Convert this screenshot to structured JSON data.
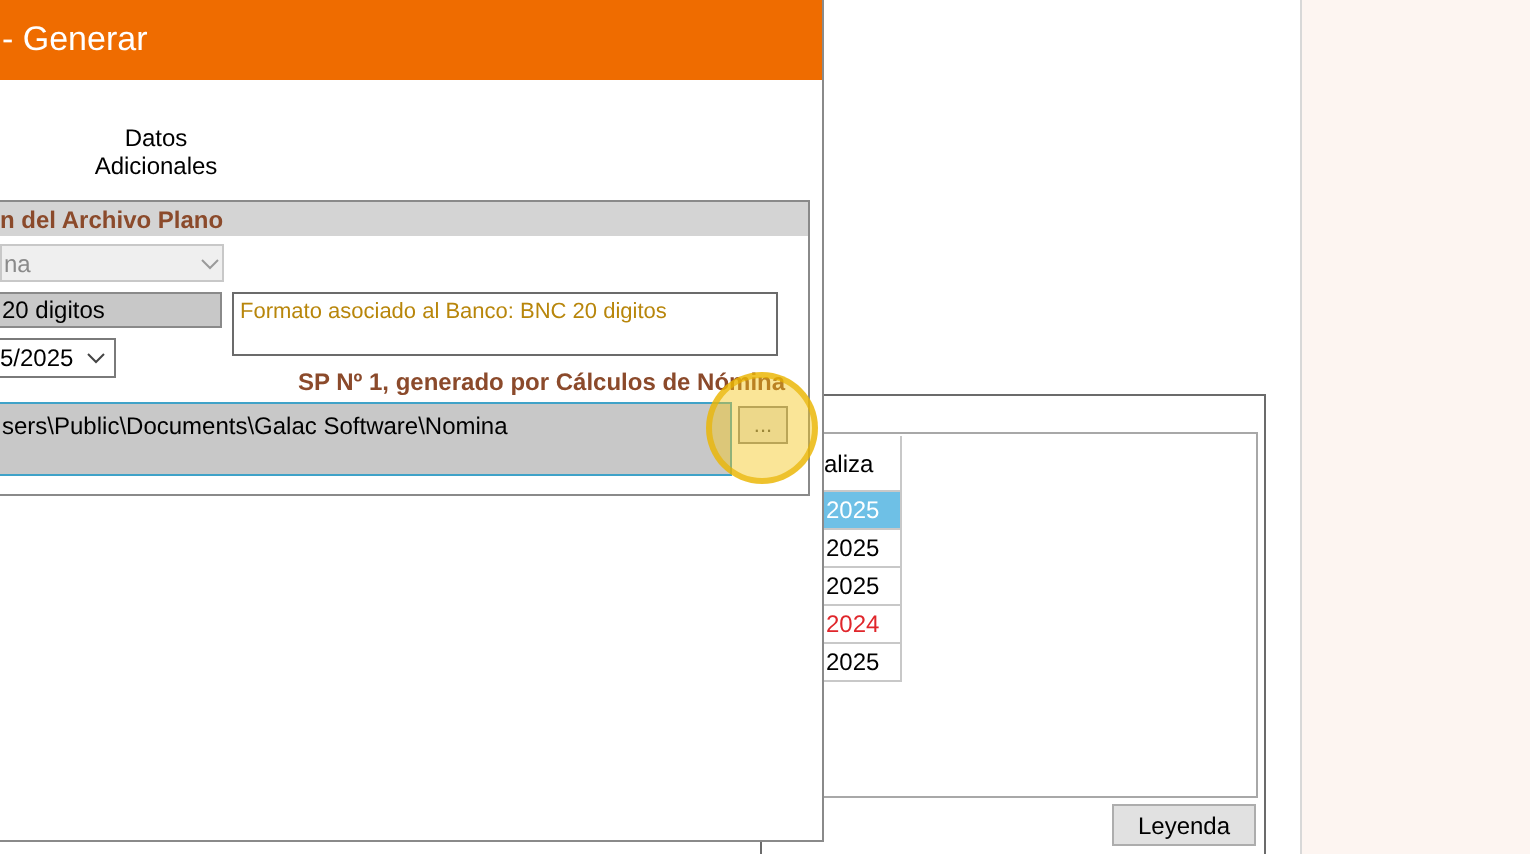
{
  "back_window": {
    "table": {
      "column_header": "aliza",
      "rows": [
        {
          "value": "2025",
          "selected": true,
          "color": "#ffffff"
        },
        {
          "value": "2025",
          "selected": false,
          "color": "#000000"
        },
        {
          "value": "2025",
          "selected": false,
          "color": "#000000"
        },
        {
          "value": "2024",
          "selected": false,
          "color": "#e0262b"
        },
        {
          "value": "2025",
          "selected": false,
          "color": "#000000"
        }
      ]
    },
    "legend_button": "Leyenda"
  },
  "dialog": {
    "title": "- Generar",
    "tab": "Datos Adicionales",
    "group": {
      "title": "n del Archivo Plano",
      "combo": {
        "value": "na",
        "disabled": true
      },
      "format_field": "20 digitos",
      "format_description": "Formato asociado al Banco: BNC 20 digitos",
      "date_combo": "5/2025",
      "source_note": "SP Nº 1, generado por Cálculos de Nómina",
      "path_field": "sers\\Public\\Documents\\Galac Software\\Nomina",
      "browse_button": "...",
      "highlighted": true
    }
  }
}
